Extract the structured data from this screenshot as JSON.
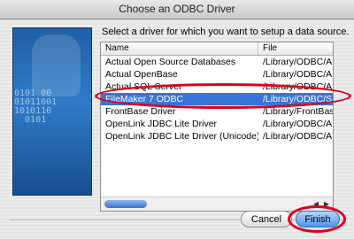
{
  "window": {
    "title": "Choose an ODBC Driver"
  },
  "instructions": "Select a driver for which you want to setup a data source.",
  "side_image": {
    "bits_text": "0101 00\n01011001\n1010110\n  0101"
  },
  "table": {
    "columns": [
      "Name",
      "File"
    ],
    "rows": [
      {
        "name": "Actual Open Source Databases",
        "file": "/Library/ODBC/A"
      },
      {
        "name": "Actual OpenBase",
        "file": "/Library/ODBC/A"
      },
      {
        "name": "Actual SQL Server",
        "file": "/Library/ODBC/A"
      },
      {
        "name": "FileMaker 7 ODBC",
        "file": "/Library/ODBC/S"
      },
      {
        "name": "FrontBase Driver",
        "file": "/Library/FrontBas"
      },
      {
        "name": "OpenLink JDBC Lite Driver",
        "file": "/Library/ODBC/A"
      },
      {
        "name": "OpenLink JDBC Lite Driver (Unicode)",
        "file": "/Library/ODBC/A"
      }
    ],
    "selected_row": "FileMaker 7 ODBC"
  },
  "buttons": {
    "cancel": "Cancel",
    "finish": "Finish"
  },
  "colors": {
    "selection": "#3875d7",
    "annotation": "#e0001b",
    "default_button": "#4d94ee"
  },
  "icons": {
    "scroll_left": "triangle-left-icon",
    "scroll_right": "triangle-right-icon"
  }
}
